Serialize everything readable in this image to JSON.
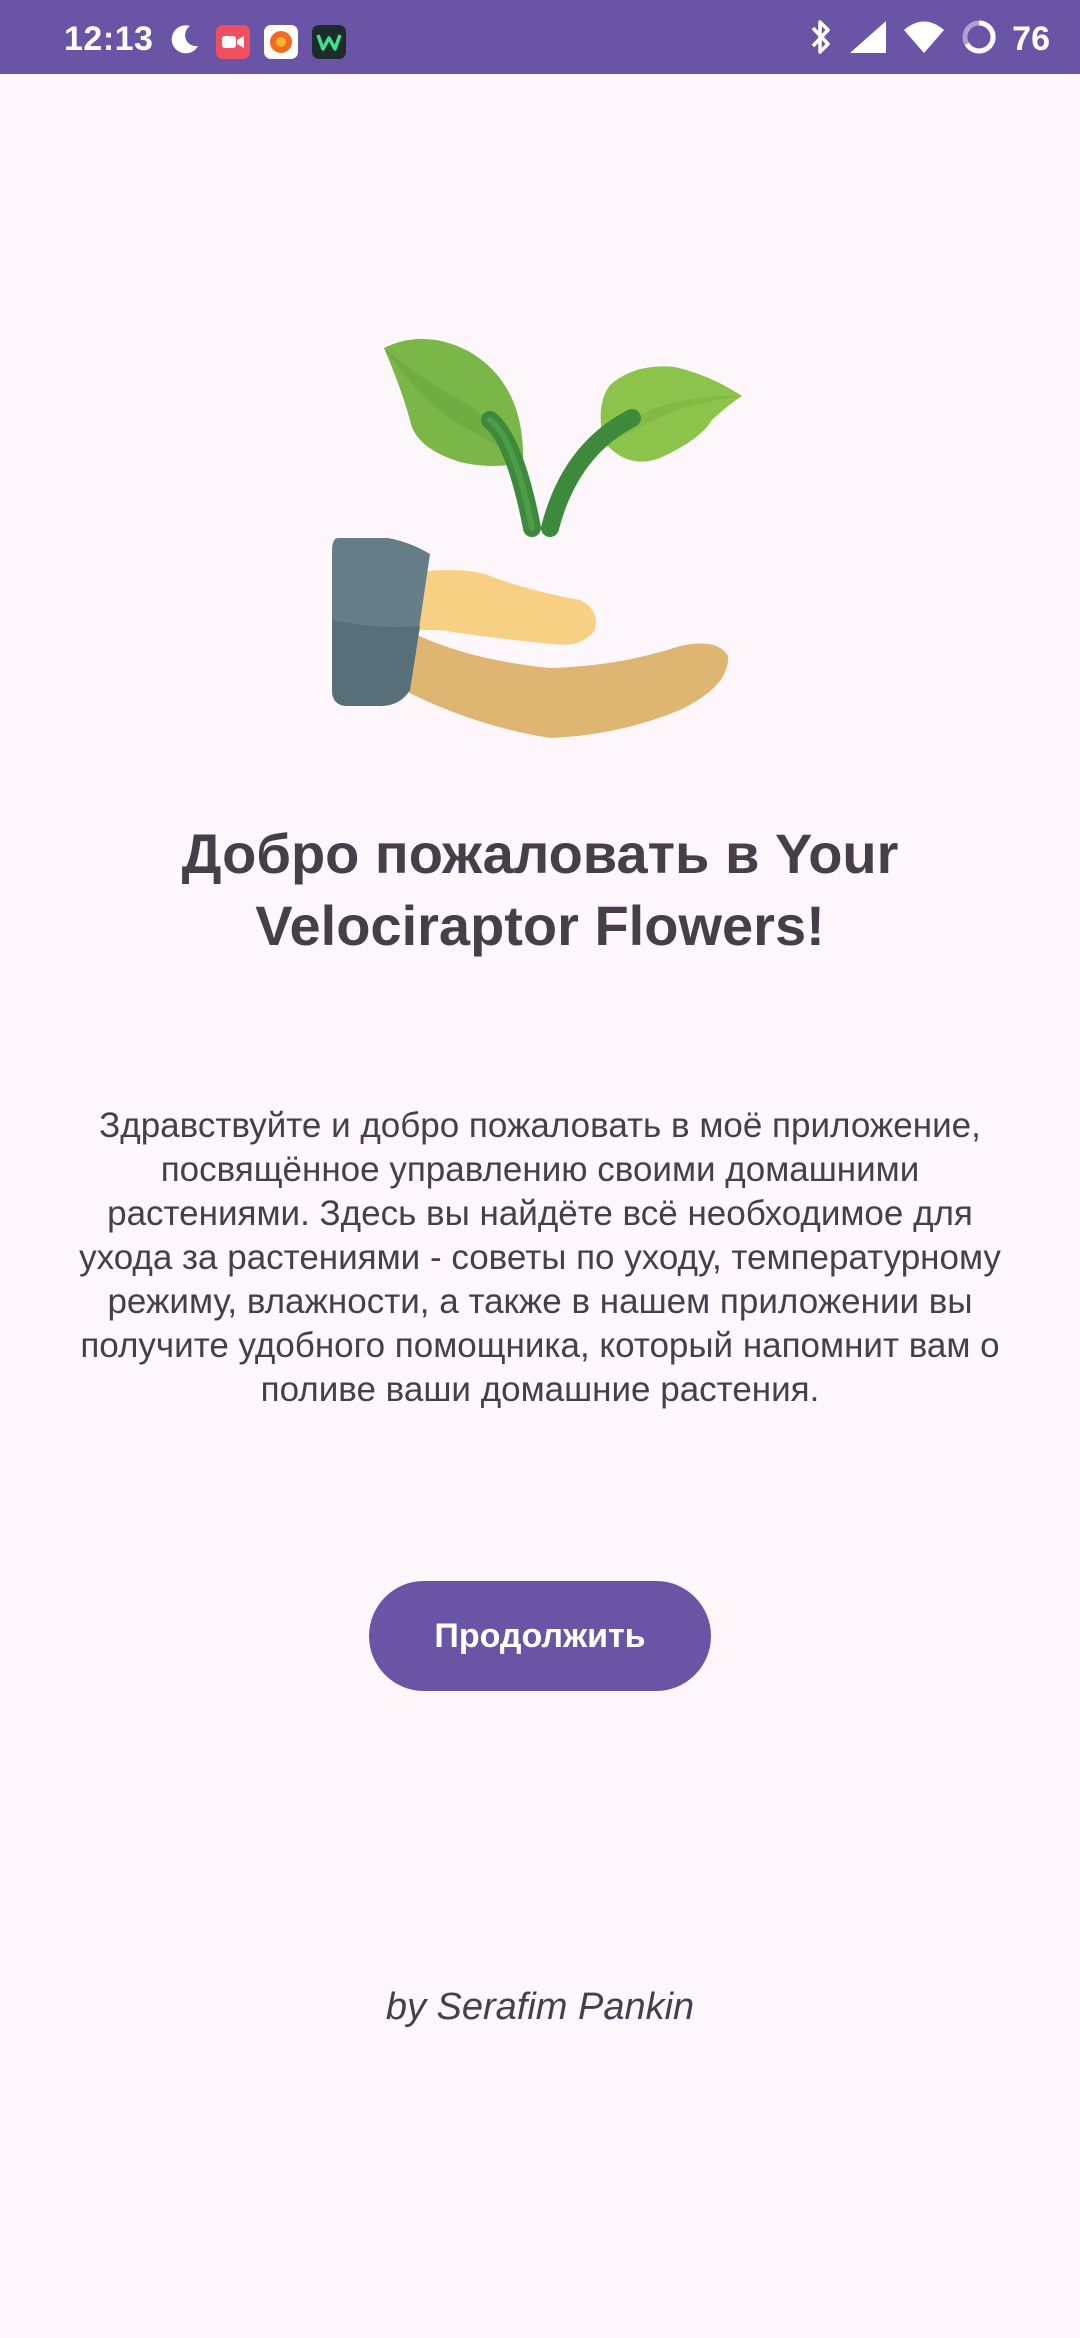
{
  "status_bar": {
    "time": "12:13",
    "battery": "76",
    "background": "#6a54a6",
    "icons": [
      "moon-icon",
      "video-app-icon",
      "orange-app-icon",
      "w-app-icon",
      "bluetooth-icon",
      "signal-icon",
      "wifi-icon",
      "battery-ring-icon"
    ]
  },
  "welcome": {
    "title": "Добро пожаловать в Your Velociraptor Flowers!",
    "description": "Здравствуйте и добро пожаловать в моё приложение, посвящённое управлению своими домашними растениями. Здесь вы найдёте всё необходимое для ухода за растениями - советы по уходу, температурному режиму, влажности, а также в нашем приложении вы получите удобного помощника, который напомнит вам о поливе ваши домашние растения.",
    "continue_label": "Продолжить",
    "author": "by Serafim Pankin",
    "accent": "#6a54a6",
    "illustration": "hand-with-seedling-icon"
  }
}
